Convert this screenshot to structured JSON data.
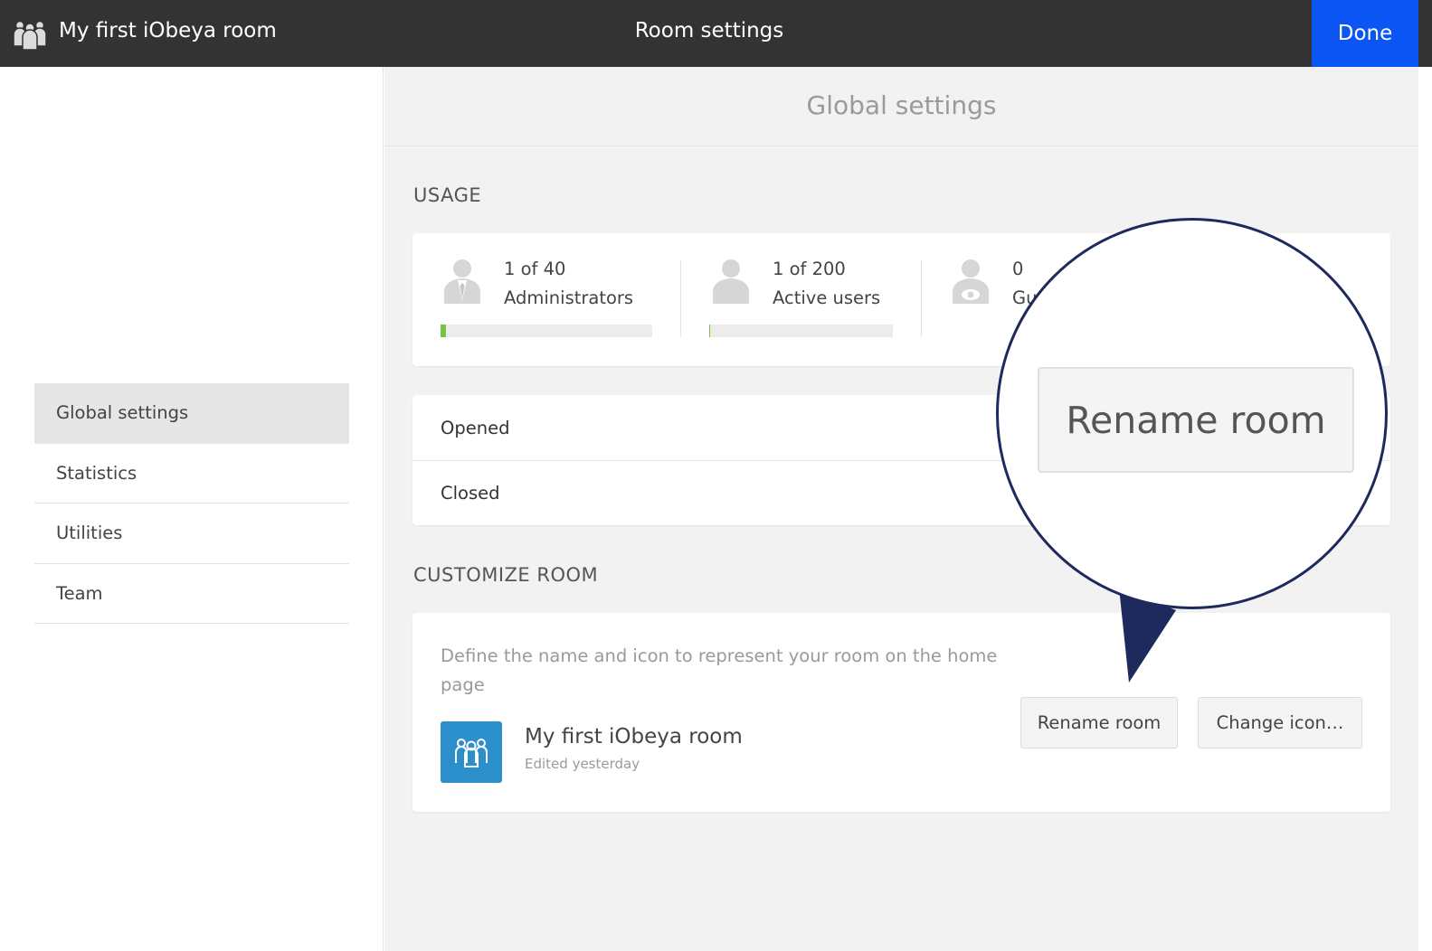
{
  "topbar": {
    "room_name": "My first iObeya room",
    "page_title": "Room settings",
    "done_label": "Done",
    "room_icon": "team-icon"
  },
  "sidebar": {
    "items": [
      {
        "label": "Global settings",
        "active": true
      },
      {
        "label": "Statistics",
        "active": false
      },
      {
        "label": "Utilities",
        "active": false
      },
      {
        "label": "Team",
        "active": false
      }
    ]
  },
  "main": {
    "header": "Global settings",
    "usage": {
      "title": "USAGE",
      "items": [
        {
          "count": "1 of 40",
          "label": "Administrators",
          "icon": "admin-user-icon",
          "fill_fraction": 0.025
        },
        {
          "count": "1 of 200",
          "label": "Active users",
          "icon": "user-icon",
          "fill_fraction": 0.005
        },
        {
          "count": "0",
          "label": "Gu",
          "icon": "guest-user-icon"
        }
      ]
    },
    "status": {
      "rows": [
        {
          "label": "Opened"
        },
        {
          "label": "Closed"
        }
      ]
    },
    "customize": {
      "title": "CUSTOMIZE ROOM",
      "description": "Define the name and icon to represent your room on the home page",
      "room_name": "My first iObeya room",
      "edited": "Edited yesterday",
      "rename_label": "Rename room",
      "change_icon_label": "Change icon…",
      "room_icon": "team-icon"
    }
  },
  "magnifier": {
    "button_label": "Rename room"
  },
  "colors": {
    "topbar": "#333333",
    "done": "#0b55f5",
    "bar_fill": "#76c442",
    "room_icon_bg": "#2b8fcc",
    "callout": "#1e2a5e"
  }
}
